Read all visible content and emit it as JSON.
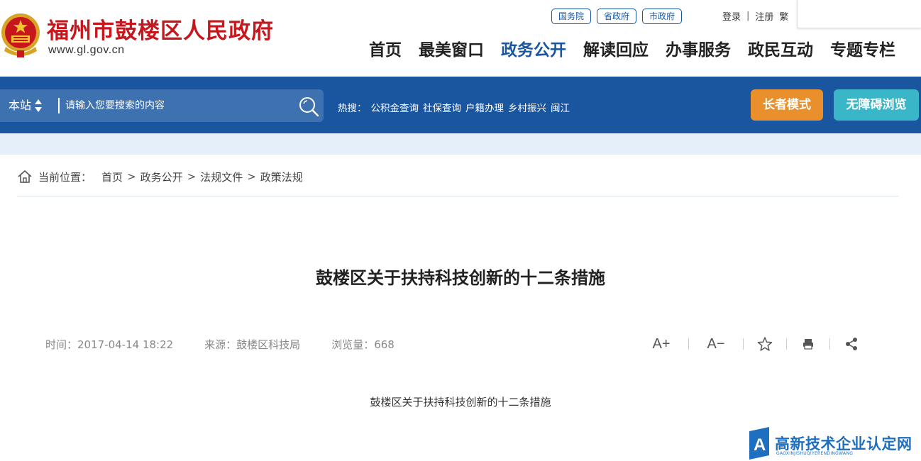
{
  "header": {
    "site_title": "福州市鼓楼区人民政府",
    "site_url": "www.gl.gov.cn",
    "gov_links": [
      "国务院",
      "省政府",
      "市政府"
    ],
    "account": {
      "login": "登录",
      "separator": "|",
      "register": "注册",
      "traditional": "繁"
    },
    "nav": [
      "首页",
      "最美窗口",
      "政务公开",
      "解读回应",
      "办事服务",
      "政民互动",
      "专题专栏"
    ],
    "nav_active_index": 2
  },
  "search": {
    "scope_label": "本站",
    "placeholder": "请输入您要搜索的内容",
    "hot_label": "热搜：",
    "hot_items": [
      "公积金查询",
      "社保查询",
      "户籍办理",
      "乡村振兴",
      "闽江"
    ]
  },
  "modes": {
    "elder": "长者模式",
    "accessible": "无障碍浏览"
  },
  "breadcrumb": {
    "label": "当前位置：",
    "items": [
      "首页",
      "政务公开",
      "法规文件",
      "政策法规"
    ],
    "separator": ">"
  },
  "article": {
    "title": "鼓楼区关于扶持科技创新的十二条措施",
    "meta": {
      "time": "时间：2017-04-14 18:22",
      "source": "来源：鼓楼区科技局",
      "views": "浏览量：668"
    },
    "tools": {
      "font_up": "A+",
      "font_down": "A−"
    },
    "body": "鼓楼区关于扶持科技创新的十二条措施"
  },
  "watermark": {
    "text": "高新技术企业认定网",
    "sub": "GAOXINJISHUQIYERENDINGWANG"
  },
  "colors": {
    "brand_red": "#c8161d",
    "brand_blue": "#1a56a0",
    "elder_orange": "#e9902c",
    "access_teal": "#39b6c8"
  }
}
